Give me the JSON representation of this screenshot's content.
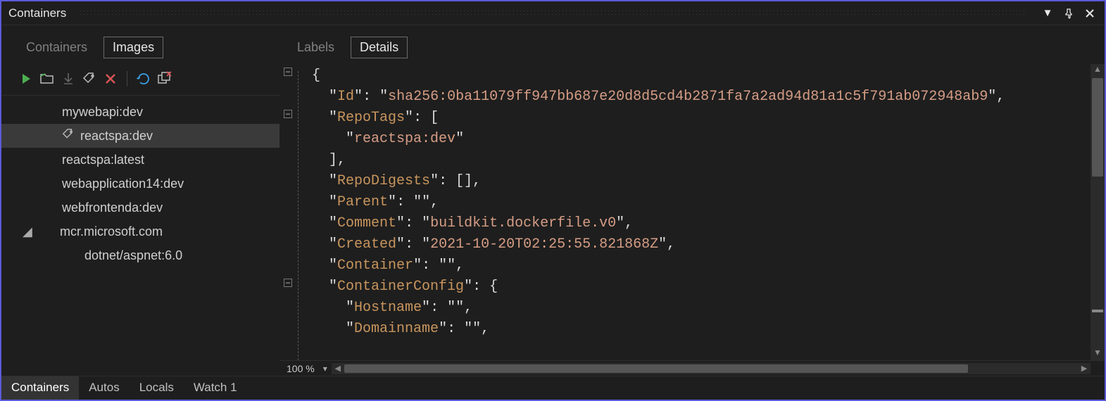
{
  "titlebar": {
    "title": "Containers"
  },
  "left": {
    "tabs": {
      "containers": "Containers",
      "images": "Images",
      "selected": "images"
    },
    "images": [
      {
        "level": 1,
        "label": "mywebapi:dev",
        "selected": false
      },
      {
        "level": 1,
        "label": "reactspa:dev",
        "selected": true
      },
      {
        "level": 1,
        "label": "reactspa:latest",
        "selected": false
      },
      {
        "level": 1,
        "label": "webapplication14:dev",
        "selected": false
      },
      {
        "level": 1,
        "label": "webfrontenda:dev",
        "selected": false
      },
      {
        "level": 0,
        "label": "mcr.microsoft.com",
        "selected": false,
        "expander": "open"
      },
      {
        "level": 2,
        "label": "dotnet/aspnet:6.0",
        "selected": false
      }
    ]
  },
  "right": {
    "tabs": {
      "labels": "Labels",
      "details": "Details",
      "selected": "details"
    },
    "zoom": "100 %",
    "json": {
      "Id": "sha256:0ba11079ff947bb687e20d8d5cd4b2871fa7a2ad94d81a1c5f791ab072948ab9",
      "RepoTags": [
        "reactspa:dev"
      ],
      "RepoDigests": [],
      "Parent": "",
      "Comment": "buildkit.dockerfile.v0",
      "Created": "2021-10-20T02:25:55.821868Z",
      "Container": "",
      "ContainerConfig": {
        "Hostname": "",
        "Domainname": ""
      }
    }
  },
  "bottomTabs": {
    "items": [
      "Containers",
      "Autos",
      "Locals",
      "Watch 1"
    ],
    "active": 0
  }
}
